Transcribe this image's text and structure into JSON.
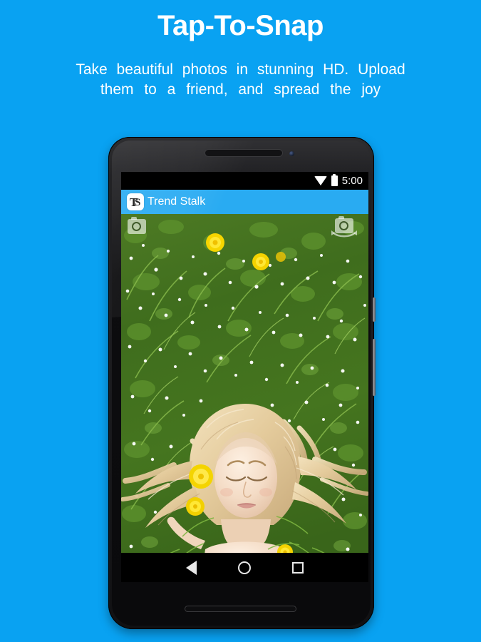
{
  "promo": {
    "title": "Tap-To-Snap",
    "subtitle_line1": "Take beautiful photos in stunning HD. Upload",
    "subtitle_line2": "them to a friend, and spread the joy"
  },
  "colors": {
    "background": "#09a2f2",
    "appbar": "#29abf2",
    "text_on_blue": "#ffffff",
    "navbar": "#000000",
    "icon_light": "#e8e8e8"
  },
  "phone": {
    "device_name": "android-phone-mockup",
    "hardware": {
      "earpiece": "earpiece-speaker",
      "front_camera": "front-camera-lens",
      "power_button": "power-button",
      "volume_button": "volume-rocker",
      "bottom_speaker": "bottom-speaker-grille"
    },
    "statusbar": {
      "time": "5:00",
      "wifi_icon": "wifi-icon",
      "battery_icon": "battery-full-icon"
    },
    "appbar": {
      "logo_icon": "trend-stalk-logo-icon",
      "logo_letter_primary": "T",
      "logo_letter_secondary": "S",
      "title": "Trend Stalk"
    },
    "screen_actions": [
      {
        "name": "capture-photo-button",
        "icon": "camera-icon"
      },
      {
        "name": "switch-camera-button",
        "icon": "camera-switch-icon"
      }
    ],
    "photo": {
      "description": "Blonde woman lying in flowering green grass with dandelions",
      "subject": "woman-lying-in-grass"
    },
    "navbar": [
      {
        "name": "nav-back-button",
        "icon": "back-triangle-icon"
      },
      {
        "name": "nav-home-button",
        "icon": "home-circle-icon"
      },
      {
        "name": "nav-recents-button",
        "icon": "recents-square-icon"
      }
    ]
  }
}
